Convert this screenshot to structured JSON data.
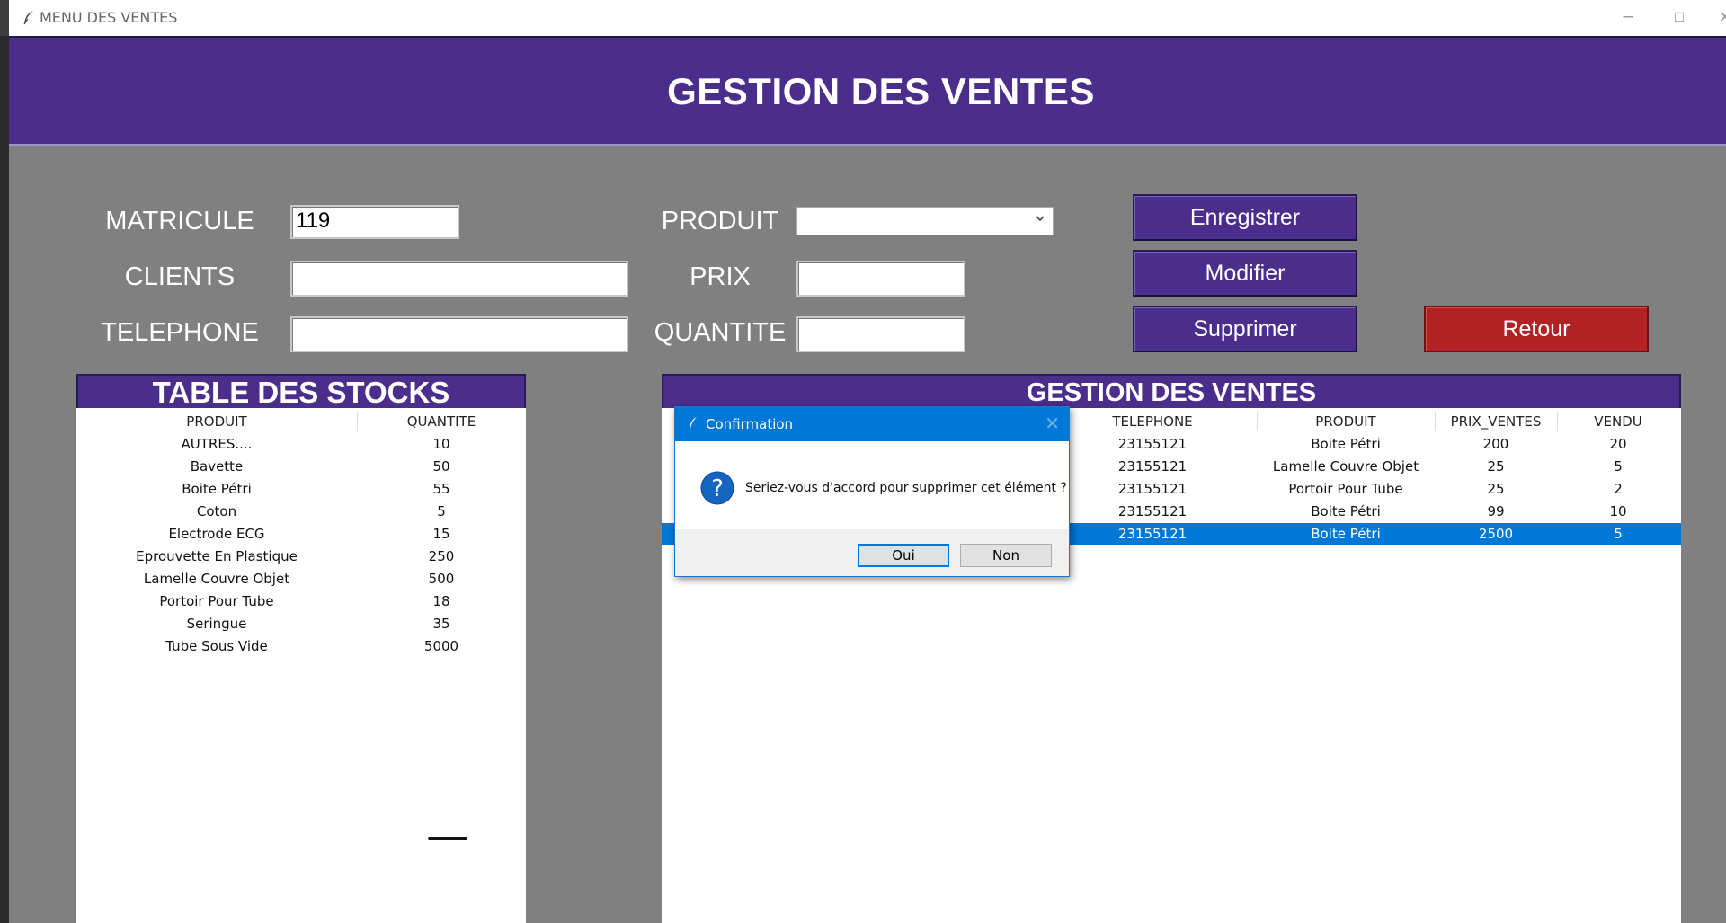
{
  "window": {
    "title": "MENU DES VENTES"
  },
  "header": {
    "title": "GESTION DES VENTES"
  },
  "form": {
    "matricule_label": "MATRICULE",
    "matricule_value": "119",
    "clients_label": "CLIENTS",
    "clients_value": "",
    "telephone_label": "TELEPHONE",
    "telephone_value": "",
    "produit_label": "PRODUIT",
    "produit_value": "",
    "prix_label": "PRIX",
    "prix_value": "",
    "quantite_label": "QUANTITE",
    "quantite_value": ""
  },
  "buttons": {
    "enregistrer": "Enregistrer",
    "modifier": "Modifier",
    "supprimer": "Supprimer",
    "retour": "Retour"
  },
  "stocks": {
    "title": "TABLE DES STOCKS",
    "columns": [
      "PRODUIT",
      "QUANTITE"
    ],
    "rows": [
      [
        "AUTRES....",
        "10"
      ],
      [
        "Bavette",
        "50"
      ],
      [
        "Boite Pétri",
        "55"
      ],
      [
        "Coton",
        "5"
      ],
      [
        "Electrode ECG",
        "15"
      ],
      [
        "Eprouvette En Plastique",
        "250"
      ],
      [
        "Lamelle Couvre Objet",
        "500"
      ],
      [
        "Portoir Pour Tube",
        "18"
      ],
      [
        "Seringue",
        "35"
      ],
      [
        "Tube Sous Vide",
        "5000"
      ]
    ]
  },
  "ventes": {
    "title": "GESTION DES VENTES",
    "columns": [
      "TELEPHONE",
      "PRODUIT",
      "PRIX_VENTES",
      "VENDU"
    ],
    "rows": [
      [
        "23155121",
        "Boite Pétri",
        "200",
        "20"
      ],
      [
        "23155121",
        "Lamelle Couvre Objet",
        "25",
        "5"
      ],
      [
        "23155121",
        "Portoir Pour Tube",
        "25",
        "2"
      ],
      [
        "23155121",
        "Boite Pétri",
        "99",
        "10"
      ],
      [
        "23155121",
        "Boite Pétri",
        "2500",
        "5"
      ]
    ],
    "selected_row": 4
  },
  "dialog": {
    "title": "Confirmation",
    "message": "Seriez-vous d'accord pour supprimer cet élément ?",
    "yes": "Oui",
    "no": "Non",
    "icon": "question-icon"
  },
  "colors": {
    "accent": "#4b2d8c",
    "danger": "#b22222",
    "selection": "#0078d7",
    "background": "#808080"
  }
}
